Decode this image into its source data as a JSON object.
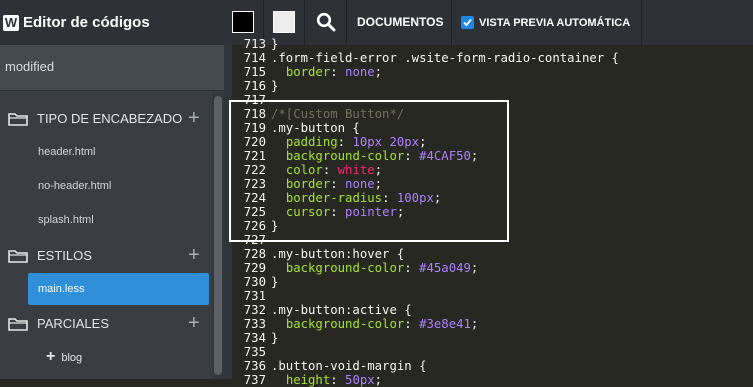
{
  "app": {
    "title": "Editor de códigos",
    "logo": "W",
    "status": "modified"
  },
  "toolbar": {
    "swatch_dark": "#000000",
    "swatch_light": "#eeeeee",
    "documents_label": "DOCUMENTOS",
    "preview_label": "VISTA PREVIA AUTOMÁTICA",
    "preview_checked": true
  },
  "sidebar": {
    "header_section": "TIPO DE ENCABEZADO",
    "header_files": [
      "header.html",
      "no-header.html",
      "splash.html"
    ],
    "styles_section": "ESTILOS",
    "styles_files": [
      "main.less"
    ],
    "partials_section": "PARCIALES",
    "partials_items": [
      "blog"
    ]
  },
  "editor": {
    "lines": [
      {
        "n": "713",
        "tokens": [
          {
            "t": "}",
            "c": ""
          }
        ]
      },
      {
        "n": "714",
        "tokens": [
          {
            "t": ".form-field-error .wsite-form-radio-container {",
            "c": ""
          }
        ]
      },
      {
        "n": "715",
        "tokens": [
          {
            "t": "  ",
            "c": ""
          },
          {
            "t": "border",
            "c": "prop"
          },
          {
            "t": ": ",
            "c": ""
          },
          {
            "t": "none",
            "c": "num"
          },
          {
            "t": ";",
            "c": ""
          }
        ]
      },
      {
        "n": "716",
        "tokens": [
          {
            "t": "}",
            "c": ""
          }
        ]
      },
      {
        "n": "717",
        "tokens": []
      },
      {
        "n": "718",
        "tokens": [
          {
            "t": "/*[Custom Button*/",
            "c": "comment"
          }
        ]
      },
      {
        "n": "719",
        "tokens": [
          {
            "t": ".my-button {",
            "c": ""
          }
        ]
      },
      {
        "n": "720",
        "tokens": [
          {
            "t": "  ",
            "c": ""
          },
          {
            "t": "padding",
            "c": "prop"
          },
          {
            "t": ": ",
            "c": ""
          },
          {
            "t": "10px 20px",
            "c": "num"
          },
          {
            "t": ";",
            "c": ""
          }
        ]
      },
      {
        "n": "721",
        "tokens": [
          {
            "t": "  ",
            "c": ""
          },
          {
            "t": "background-color",
            "c": "prop"
          },
          {
            "t": ": ",
            "c": ""
          },
          {
            "t": "#4CAF50",
            "c": "num"
          },
          {
            "t": ";",
            "c": ""
          }
        ]
      },
      {
        "n": "722",
        "tokens": [
          {
            "t": "  ",
            "c": ""
          },
          {
            "t": "color",
            "c": "prop"
          },
          {
            "t": ": ",
            "c": ""
          },
          {
            "t": "white",
            "c": "str"
          },
          {
            "t": ";",
            "c": ""
          }
        ]
      },
      {
        "n": "723",
        "tokens": [
          {
            "t": "  ",
            "c": ""
          },
          {
            "t": "border",
            "c": "prop"
          },
          {
            "t": ": ",
            "c": ""
          },
          {
            "t": "none",
            "c": "num"
          },
          {
            "t": ";",
            "c": ""
          }
        ]
      },
      {
        "n": "724",
        "tokens": [
          {
            "t": "  ",
            "c": ""
          },
          {
            "t": "border-radius",
            "c": "prop"
          },
          {
            "t": ": ",
            "c": ""
          },
          {
            "t": "100px",
            "c": "num"
          },
          {
            "t": ";",
            "c": ""
          }
        ]
      },
      {
        "n": "725",
        "tokens": [
          {
            "t": "  ",
            "c": ""
          },
          {
            "t": "cursor",
            "c": "prop"
          },
          {
            "t": ": ",
            "c": ""
          },
          {
            "t": "pointer",
            "c": "num"
          },
          {
            "t": ";",
            "c": ""
          }
        ]
      },
      {
        "n": "726",
        "tokens": [
          {
            "t": "}",
            "c": ""
          }
        ]
      },
      {
        "n": "727",
        "tokens": []
      },
      {
        "n": "728",
        "tokens": [
          {
            "t": ".my-button:hover {",
            "c": ""
          }
        ]
      },
      {
        "n": "729",
        "tokens": [
          {
            "t": "  ",
            "c": ""
          },
          {
            "t": "background-color",
            "c": "prop"
          },
          {
            "t": ": ",
            "c": ""
          },
          {
            "t": "#45a049",
            "c": "num"
          },
          {
            "t": ";",
            "c": ""
          }
        ]
      },
      {
        "n": "730",
        "tokens": [
          {
            "t": "}",
            "c": ""
          }
        ]
      },
      {
        "n": "731",
        "tokens": []
      },
      {
        "n": "732",
        "tokens": [
          {
            "t": ".my-button:active {",
            "c": ""
          }
        ]
      },
      {
        "n": "733",
        "tokens": [
          {
            "t": "  ",
            "c": ""
          },
          {
            "t": "background-color",
            "c": "prop"
          },
          {
            "t": ": ",
            "c": ""
          },
          {
            "t": "#3e8e41",
            "c": "num"
          },
          {
            "t": ";",
            "c": ""
          }
        ]
      },
      {
        "n": "734",
        "tokens": [
          {
            "t": "}",
            "c": ""
          }
        ]
      },
      {
        "n": "735",
        "tokens": []
      },
      {
        "n": "736",
        "tokens": [
          {
            "t": ".button-void-margin {",
            "c": ""
          }
        ]
      },
      {
        "n": "737",
        "tokens": [
          {
            "t": "  ",
            "c": ""
          },
          {
            "t": "height",
            "c": "prop"
          },
          {
            "t": ": ",
            "c": ""
          },
          {
            "t": "50px",
            "c": "num"
          },
          {
            "t": ";",
            "c": ""
          }
        ]
      }
    ]
  },
  "colors": {
    "accent": "#2f8fd8",
    "editor_bg": "#272822",
    "highlight": "#ffffff"
  }
}
